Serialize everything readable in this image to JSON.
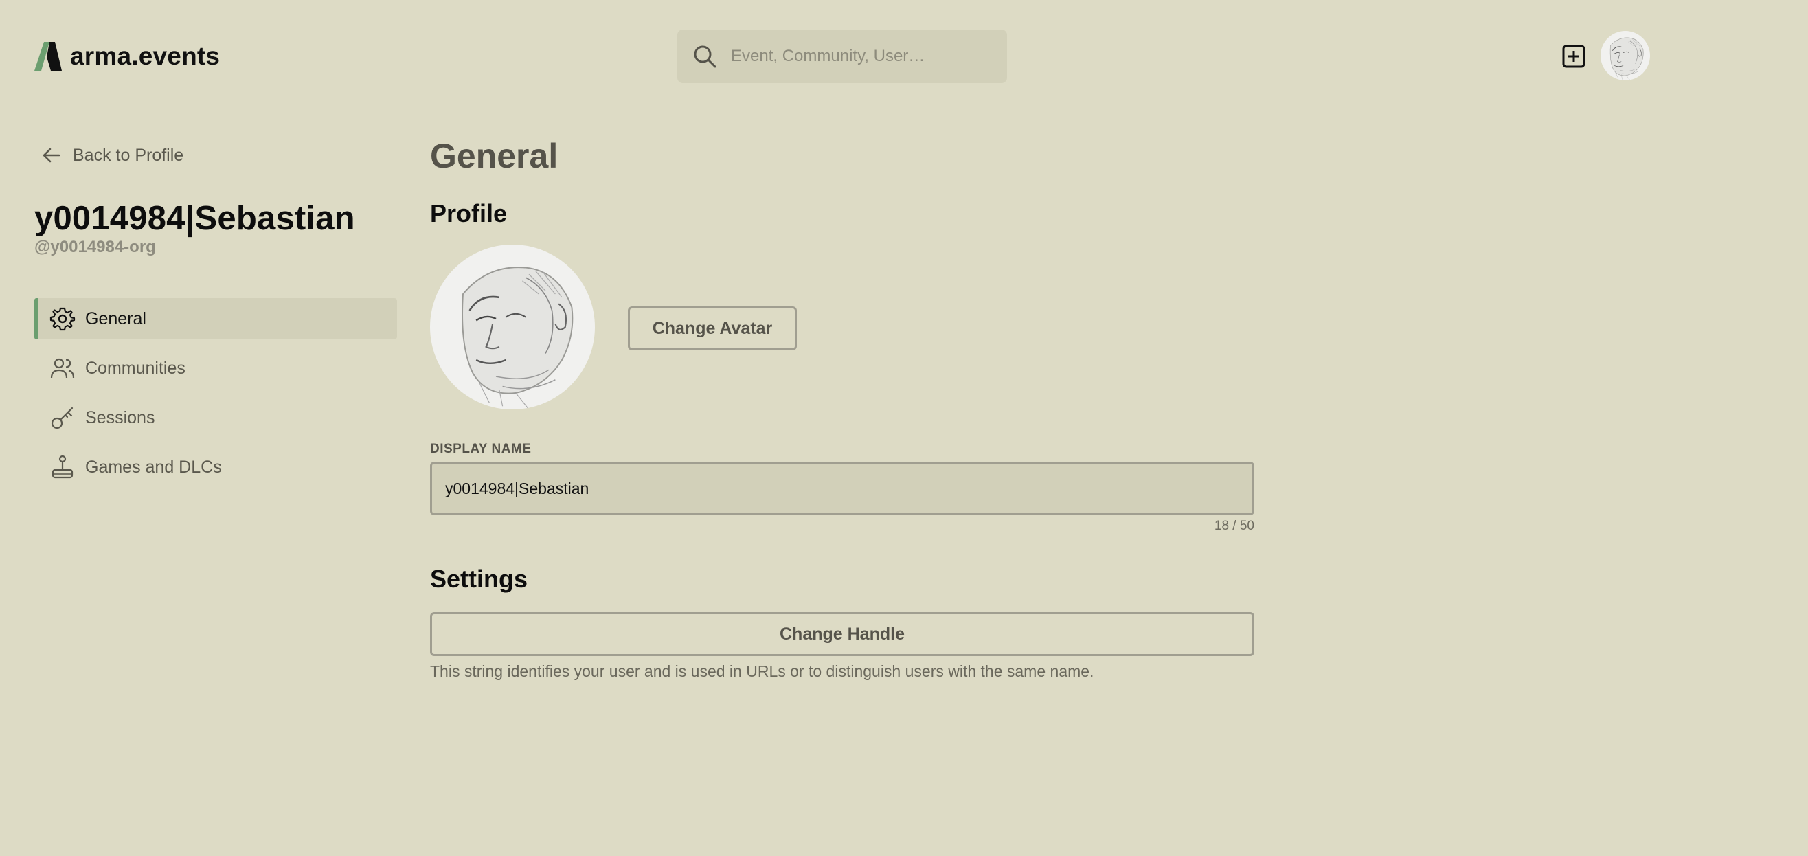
{
  "app": {
    "brand": "arma.events",
    "colors": {
      "background": "#dddbc5",
      "accent": "#6b9e6f",
      "panel": "#d2d0b9",
      "border": "#a09e90"
    }
  },
  "header": {
    "search_placeholder": "Event, Community, User…",
    "search_value": "",
    "icons": {
      "search": "search-icon",
      "add": "plus-square-icon",
      "avatar": "user-avatar"
    }
  },
  "sidebar": {
    "back_label": "Back to Profile",
    "user_name": "y0014984|Sebastian",
    "user_handle": "@y0014984-org",
    "items": [
      {
        "label": "General",
        "icon": "gear-icon",
        "active": true
      },
      {
        "label": "Communities",
        "icon": "users-icon",
        "active": false
      },
      {
        "label": "Sessions",
        "icon": "key-icon",
        "active": false
      },
      {
        "label": "Games and DLCs",
        "icon": "joystick-icon",
        "active": false
      }
    ]
  },
  "main": {
    "title": "General",
    "profile": {
      "title": "Profile",
      "change_avatar_label": "Change Avatar",
      "display_name_label": "DISPLAY NAME",
      "display_name_value": "y0014984|Sebastian",
      "char_count": "18 / 50"
    },
    "settings": {
      "title": "Settings",
      "change_handle_label": "Change Handle",
      "handle_hint": "This string identifies your user and is used in URLs or to distinguish users with the same name."
    }
  }
}
